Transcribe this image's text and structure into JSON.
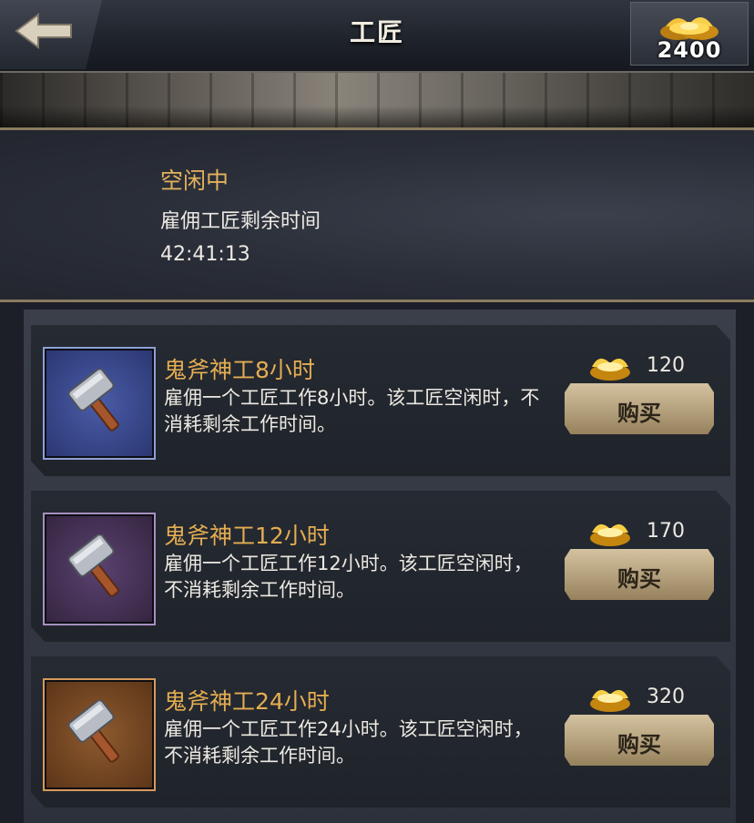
{
  "header": {
    "title": "工匠",
    "gold": "2400",
    "icons": {
      "back": "back-arrow-icon",
      "currency": "gold-ingot-icon"
    }
  },
  "status": {
    "state": "空闲中",
    "label": "雇佣工匠剩余时间",
    "time": "42:41:13"
  },
  "items": [
    {
      "title": "鬼斧神工8小时",
      "desc": "雇佣一个工匠工作8小时。该工匠空闲时，不消耗剩余工作时间。",
      "price": "120",
      "buy": "购买",
      "slot_color": "#3a4a8a",
      "icon": "hammer-icon"
    },
    {
      "title": "鬼斧神工12小时",
      "desc": "雇佣一个工匠工作12小时。该工匠空闲时，不消耗剩余工作时间。",
      "price": "170",
      "buy": "购买",
      "slot_color": "#4a3458",
      "icon": "hammer-icon"
    },
    {
      "title": "鬼斧神工24小时",
      "desc": "雇佣一个工匠工作24小时。该工匠空闲时，不消耗剩余工作时间。",
      "price": "320",
      "buy": "购买",
      "slot_color": "#7a4a26",
      "icon": "hammer-icon"
    }
  ],
  "colors": {
    "accent_gold": "#e4ad52",
    "status_gold": "#e3b25e"
  }
}
